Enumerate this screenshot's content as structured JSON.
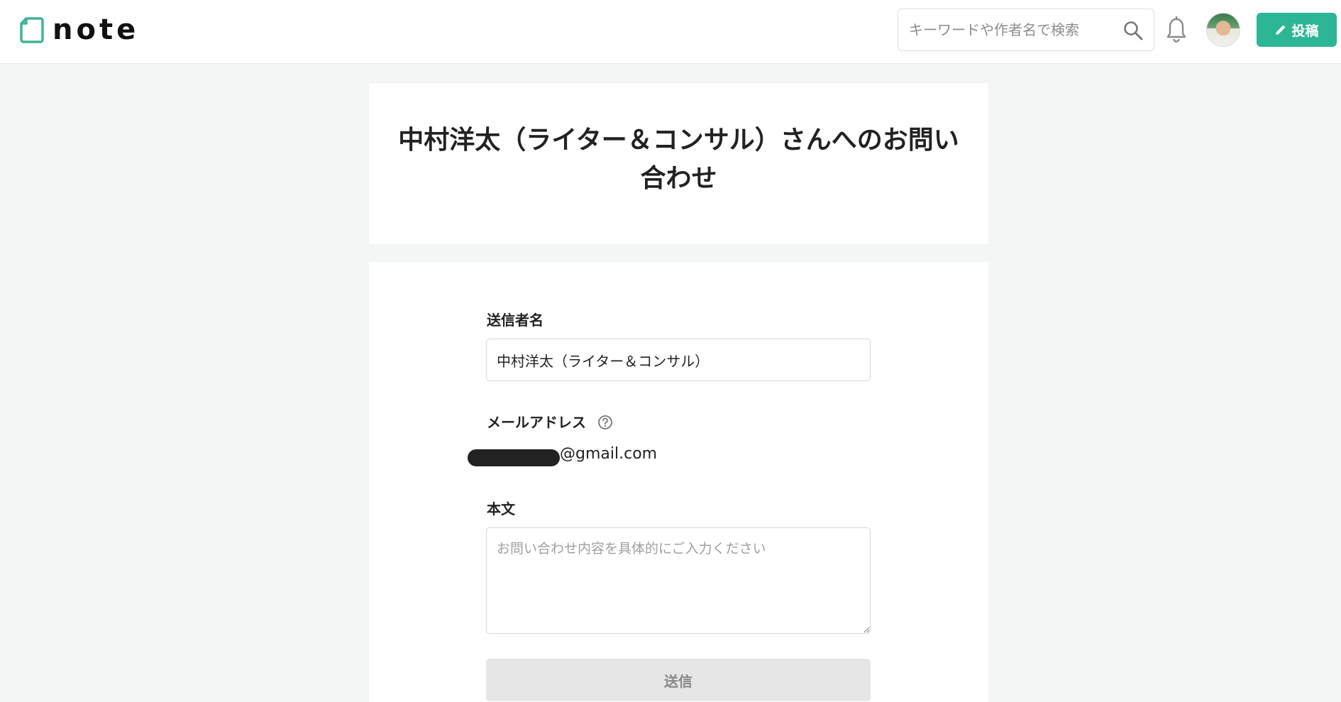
{
  "header": {
    "logo_text": "note",
    "search": {
      "placeholder": "キーワードや作者名で検索",
      "value": ""
    },
    "post_button_label": "投稿"
  },
  "title_card": {
    "title": "中村洋太（ライター＆コンサル）さんへのお問い合わせ"
  },
  "form": {
    "sender_name": {
      "label": "送信者名",
      "value": "中村洋太（ライター＆コンサル）"
    },
    "email": {
      "label": "メールアドレス",
      "visible_domain": "@gmail.com"
    },
    "body": {
      "label": "本文",
      "placeholder": "お問い合わせ内容を具体的にご入力ください",
      "value": ""
    },
    "submit_label": "送信"
  },
  "colors": {
    "brand_green": "#2cb696",
    "background": "#f4f5f5",
    "disabled_button": "#e6e6e6"
  },
  "icons": [
    "note-logo-icon",
    "search-icon",
    "bell-icon",
    "pencil-icon",
    "help-icon"
  ]
}
